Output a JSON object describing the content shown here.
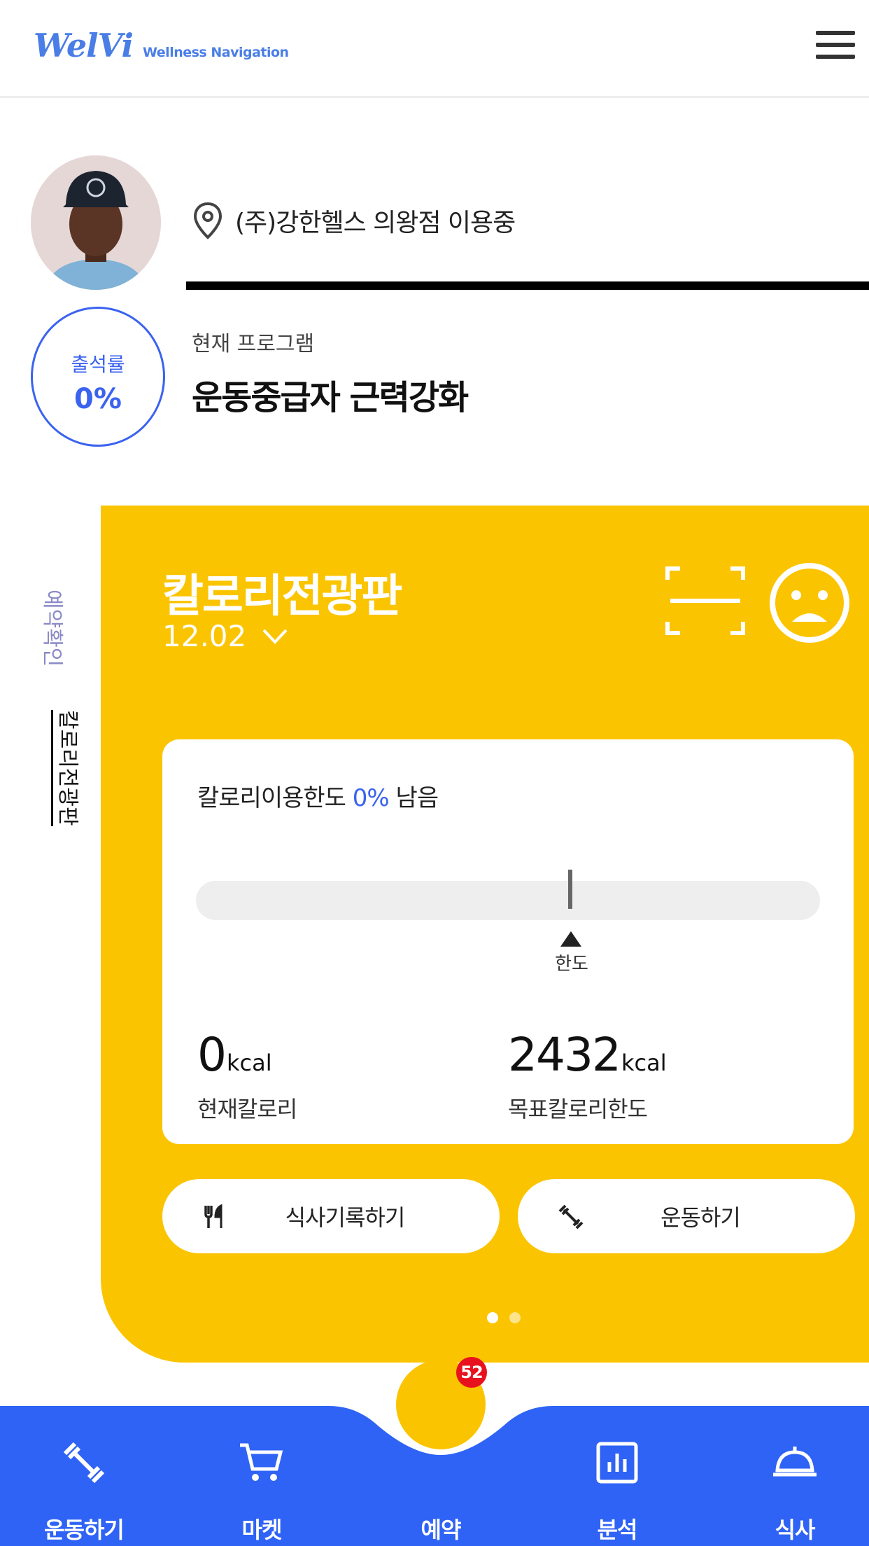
{
  "header": {
    "logo_main": "WelVi",
    "logo_sub": "Wellness Navigation",
    "menu_icon": "hamburger-menu-icon"
  },
  "profile": {
    "location": "(주)강한헬스 의왕점 이용중",
    "attendance_label": "출석률",
    "attendance_value": "0%",
    "program_label": "현재 프로그램",
    "program_name": "운동중급자 근력강화"
  },
  "side_tabs": [
    "예약확인",
    "칼로리전광판"
  ],
  "card": {
    "title": "칼로리전광판",
    "date": "12.02",
    "limit_prefix": "칼로리이용한도 ",
    "limit_percent": "0%",
    "limit_suffix": " 남음",
    "limit_marker_label": "한도",
    "current_value": "0",
    "current_unit": "kcal",
    "current_label": "현재칼로리",
    "target_value": "2432",
    "target_unit": "kcal",
    "target_label": "목표칼로리한도",
    "meal_button": "식사기록하기",
    "exercise_button": "운동하기",
    "colors": {
      "card": "#fbc400",
      "accent": "#3b63f0"
    }
  },
  "bottom_nav": {
    "badge": "52",
    "items": [
      {
        "label": "운동하기",
        "icon": "dumbbell-icon"
      },
      {
        "label": "마켓",
        "icon": "cart-icon"
      },
      {
        "label": "예약",
        "icon": ""
      },
      {
        "label": "분석",
        "icon": "chart-icon"
      },
      {
        "label": "식사",
        "icon": "cloche-icon"
      }
    ],
    "color": "#2f63f5"
  }
}
